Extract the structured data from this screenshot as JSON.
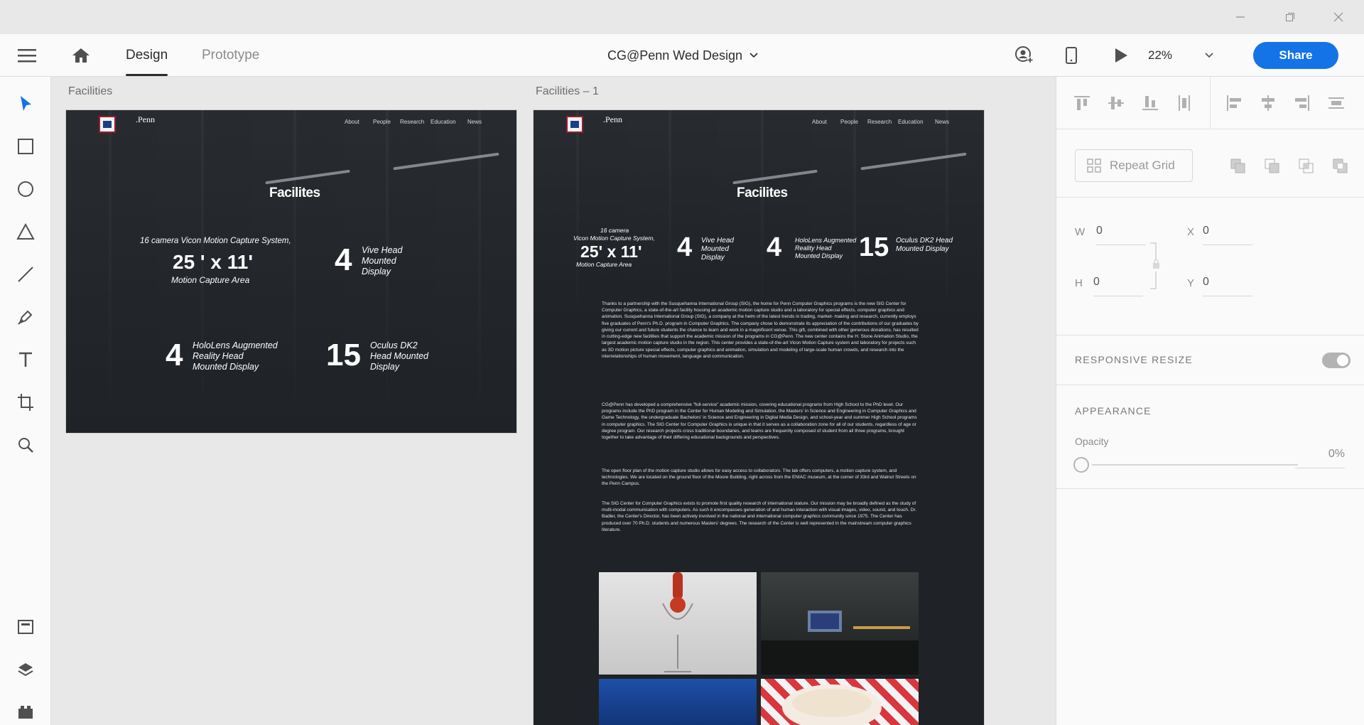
{
  "header": {
    "tab_design": "Design",
    "tab_prototype": "Prototype",
    "doc_title": "CG@Penn Wed Design",
    "zoom": "22%",
    "share": "Share"
  },
  "canvas": {
    "artboard1": {
      "label": "Facilities",
      "brand": ".Penn",
      "nav": [
        "About",
        "People",
        "Research",
        "Education",
        "News"
      ],
      "title": "Facilites",
      "stats": {
        "mocap_line1": "16 camera Vicon Motion Capture System,",
        "mocap_size": "25 ' x 11'",
        "mocap_sub": "Motion Capture Area",
        "vive_num": "4",
        "vive_txt": "Vive Head Mounted Display",
        "holo_num": "4",
        "holo_txt": "HoloLens Augmented Reality Head Mounted Display",
        "oculus_num": "15",
        "oculus_txt": "Oculus DK2 Head Mounted Display"
      }
    },
    "artboard2": {
      "label": "Facilities – 1",
      "brand": ".Penn",
      "nav": [
        "About",
        "People",
        "Research",
        "Education",
        "News"
      ],
      "title": "Facilites",
      "stats": {
        "mocap_line1": "16 camera",
        "mocap_line2": "Vicon Motion Capture System,",
        "mocap_size": "25' x 11'",
        "mocap_sub": "Motion Capture Area",
        "vive_num": "4",
        "vive_txt": "Vive Head Mounted Display",
        "holo_num": "4",
        "holo_txt": "HoloLens Augmented Reality Head Mounted Display",
        "oculus_num": "15",
        "oculus_txt": "Oculus DK2 Head Mounted Display"
      },
      "paragraphs": [
        "Thanks to a partnership with the Susquehanna International Group (SIG), the home for Penn Computer Graphics programs is the new SIG Center for Computer Graphics, a state-of-the-art facility housing an academic motion capture studio and a laboratory for special effects, computer graphics and animation. Susquehanna International Group (SIG), a company at the helm of the latest trends in trading, market- making and research, currently employs five graduates of Penn's Ph.D. program in Computer Graphics. The company chose to demonstrate its appreciation of the contributions of our graduates by giving our current and future students the chance to learn and work in a magnificent venue. This gift, combined with other generous donations, has resulted in cutting-edge new facilities that support the academic mission of the programs in CG@Penn. The new center contains the H. Stone Animation Studio, the largest academic motion capture studio in the region. This center provides a state-of-the-art Vicon Motion Capture system and laboratory for projects such as 3D motion picture special effects, computer graphics and animation, simulation and modeling of large-scale human crowds, and research into the interrelationships of human movement, language and communication.",
        "CG@Penn has developed a comprehensive \"full-service\" academic mission, covering educational programs from High School to the PhD level. Our programs include the PhD program in the Center for Human Modeling and Simulation, the Masters' in Science and Engineering in Computer Graphics and Game Technology, the undergraduate Bachelors' in Science and Engineering in Digital Media Design, and school-year and summer High School programs in computer graphics. The SIG Center for Computer Graphics is unique in that it serves as a collaboration zone for all of our students, regardless of age or degree program. Our research projects cross traditional boundaries, and teams are frequently composed of student from all three programs, brought together to take advantage of their differing educational backgrounds and perspectives.",
        "The open floor plan of the motion capture studio allows for easy access to collaborators. The lab offers computers, a motion capture system, and technologies. We are located on the ground floor of the Moore Building, right across from the ENIAC museum, at the corner of 33rd and Walnut Streets on the Penn Campus.",
        "The SIG Center for Computer Graphics exists to promote first quality research of international stature. Our mission may be broadly defined as the study of multi-modal communication with computers. As such it encompasses generation of and human interaction with visual images, video, sound, and touch. Dr. Badler, the Center's Director, has been actively involved in the national and international computer graphics community since 1975. The Center has produced over 70 Ph.D. students and numerous Masters' degrees. The research of the Center is well represented in the mainstream computer graphics literature."
      ]
    }
  },
  "panel": {
    "repeat_grid": "Repeat Grid",
    "w_label": "W",
    "w_value": "0",
    "h_label": "H",
    "h_value": "0",
    "x_label": "X",
    "x_value": "0",
    "y_label": "Y",
    "y_value": "0",
    "responsive_resize": "RESPONSIVE RESIZE",
    "appearance": "APPEARANCE",
    "opacity_label": "Opacity",
    "opacity_value": "0%"
  },
  "colors": {
    "accent": "#1473e6",
    "artboard_bg": "#1f2327"
  }
}
